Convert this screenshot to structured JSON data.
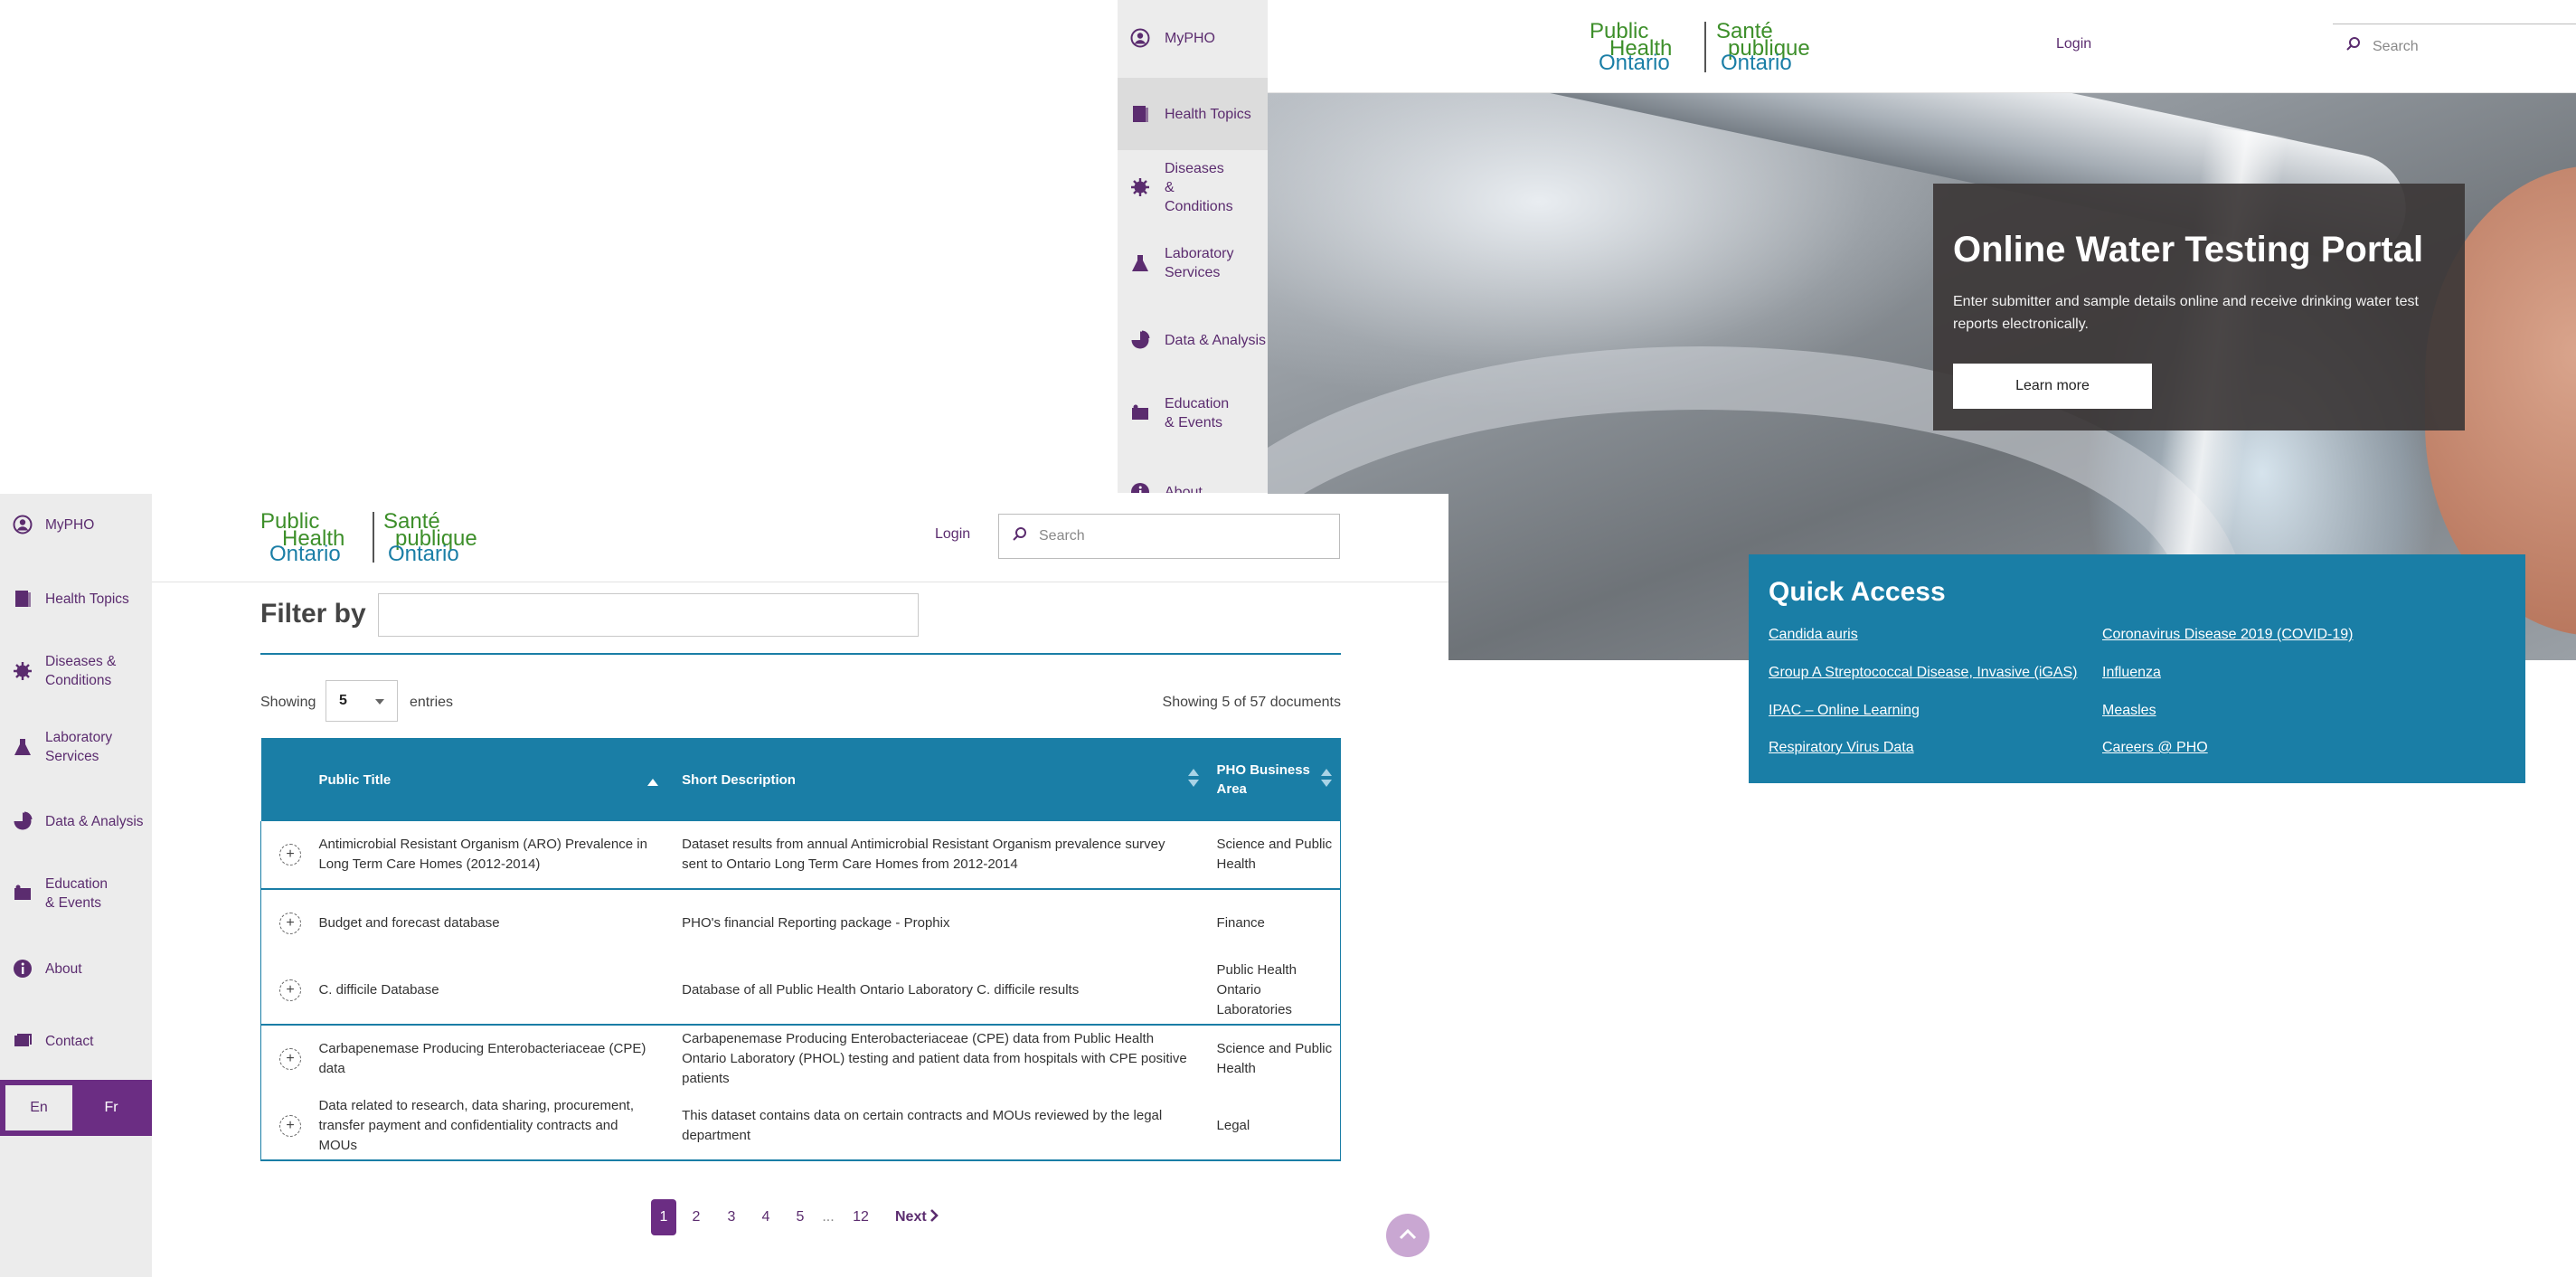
{
  "back": {
    "sidebar": [
      {
        "label": "MyPHO",
        "icon": "user-circle-icon"
      },
      {
        "label": "Health Topics",
        "icon": "book-icon"
      },
      {
        "label": "Diseases & Conditions",
        "icon": "virus-icon"
      },
      {
        "label": "Laboratory Services",
        "icon": "flask-icon"
      },
      {
        "label": "Data & Analysis",
        "icon": "pie-chart-icon"
      },
      {
        "label": "Education & Events",
        "icon": "presentation-icon"
      },
      {
        "label": "About",
        "icon": "info-icon"
      }
    ],
    "logo": {
      "line1": "Public",
      "line2": "Health",
      "line3": "Ontario",
      "fr1": "Santé",
      "fr2": "publique",
      "fr3": "Ontario"
    },
    "login": "Login",
    "search_placeholder": "Search",
    "portal": {
      "title": "Online Water Testing Portal",
      "description": "Enter submitter and sample details online and receive drinking water test reports electronically.",
      "button": "Learn more"
    },
    "quick_access": {
      "title": "Quick Access",
      "links": [
        "Candida auris",
        "Coronavirus Disease 2019 (COVID-19)",
        "Group A Streptococcal Disease, Invasive (iGAS)",
        "Influenza",
        "IPAC – Online Learning",
        "Measles",
        "Respiratory Virus Data",
        "Careers @ PHO"
      ]
    }
  },
  "front": {
    "sidebar": [
      {
        "label": "MyPHO",
        "icon": "user-circle-icon"
      },
      {
        "label": "Health Topics",
        "icon": "book-icon"
      },
      {
        "label": "Diseases & Conditions",
        "icon": "virus-icon"
      },
      {
        "label": "Laboratory Services",
        "icon": "flask-icon"
      },
      {
        "label": "Data & Analysis",
        "icon": "pie-chart-icon"
      },
      {
        "label": "Education & Events",
        "icon": "presentation-icon"
      },
      {
        "label": "About",
        "icon": "info-icon"
      },
      {
        "label": "Contact",
        "icon": "contact-icon"
      }
    ],
    "lang": {
      "en": "En",
      "fr": "Fr"
    },
    "logo": {
      "line1": "Public",
      "line2": "Health",
      "line3": "Ontario",
      "fr1": "Santé",
      "fr2": "publique",
      "fr3": "Ontario"
    },
    "login": "Login",
    "search_placeholder": "Search",
    "filter_label": "Filter by",
    "filter_value": "",
    "showing_label": "Showing",
    "entries_value": "5",
    "entries_label": "entries",
    "count_text": "Showing 5 of 57 documents",
    "table": {
      "headers": [
        "Public Title",
        "Short Description",
        "PHO Business Area"
      ],
      "rows": [
        {
          "title": "Antimicrobial Resistant Organism (ARO) Prevalence in Long Term Care Homes (2012-2014)",
          "description": "Dataset results from annual Antimicrobial Resistant Organism prevalence survey sent to Ontario Long Term Care Homes from 2012-2014",
          "area": "Science and Public Health"
        },
        {
          "title": "Budget and forecast database",
          "description": "PHO's financial Reporting package - Prophix",
          "area": "Finance"
        },
        {
          "title": "C. difficile Database",
          "description": "Database of all Public Health Ontario Laboratory C. difficile results",
          "area": "Public Health Ontario Laboratories"
        },
        {
          "title": "Carbapenemase Producing Enterobacteriaceae (CPE) data",
          "description": "Carbapenemase Producing Enterobacteriaceae (CPE) data from Public Health Ontario Laboratory (PHOL) testing and patient data from hospitals with CPE positive patients",
          "area": "Science and Public Health"
        },
        {
          "title": "Data related to research, data sharing, procurement, transfer payment and confidentiality contracts and MOUs",
          "description": "This dataset contains data on certain contracts and MOUs reviewed by the legal department",
          "area": "Legal"
        }
      ]
    },
    "pagination": {
      "pages": [
        "1",
        "2",
        "3",
        "4",
        "5",
        "...",
        "12"
      ],
      "next": "Next",
      "active": "1"
    }
  },
  "colors": {
    "purple": "#6b2d83",
    "teal": "#1a7ea6",
    "green": "#3d8f2a",
    "sidebar": "#ececec"
  }
}
